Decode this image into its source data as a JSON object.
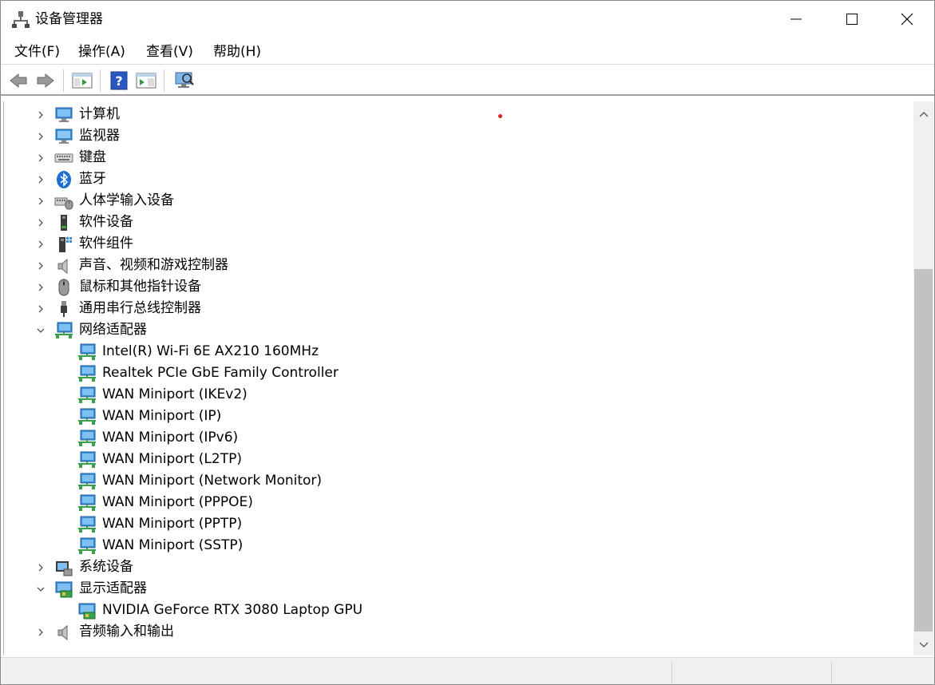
{
  "window": {
    "title": "设备管理器"
  },
  "menu": [
    "文件(F)",
    "操作(A)",
    "查看(V)",
    "帮助(H)"
  ],
  "toolbar": {
    "buttons": [
      "back-icon",
      "forward-icon",
      "properties-icon",
      "help-icon",
      "update-driver-icon",
      "scan-hardware-icon"
    ]
  },
  "tree": {
    "categories": [
      {
        "label": "计算机",
        "icon": "computer-icon",
        "expanded": false
      },
      {
        "label": "监视器",
        "icon": "monitor-icon",
        "expanded": false
      },
      {
        "label": "键盘",
        "icon": "keyboard-icon",
        "expanded": false
      },
      {
        "label": "蓝牙",
        "icon": "bluetooth-icon",
        "expanded": false
      },
      {
        "label": "人体学输入设备",
        "icon": "hid-icon",
        "expanded": false
      },
      {
        "label": "软件设备",
        "icon": "software-device-icon",
        "expanded": false
      },
      {
        "label": "软件组件",
        "icon": "software-component-icon",
        "expanded": false
      },
      {
        "label": "声音、视频和游戏控制器",
        "icon": "speaker-icon",
        "expanded": false
      },
      {
        "label": "鼠标和其他指针设备",
        "icon": "mouse-icon",
        "expanded": false
      },
      {
        "label": "通用串行总线控制器",
        "icon": "usb-icon",
        "expanded": false
      },
      {
        "label": "网络适配器",
        "icon": "network-adapter-icon",
        "expanded": true,
        "children": [
          "Intel(R) Wi-Fi 6E AX210 160MHz",
          "Realtek PCIe GbE Family Controller",
          "WAN Miniport (IKEv2)",
          "WAN Miniport (IP)",
          "WAN Miniport (IPv6)",
          "WAN Miniport (L2TP)",
          "WAN Miniport (Network Monitor)",
          "WAN Miniport (PPPOE)",
          "WAN Miniport (PPTP)",
          "WAN Miniport (SSTP)"
        ]
      },
      {
        "label": "系统设备",
        "icon": "system-device-icon",
        "expanded": false
      },
      {
        "label": "显示适配器",
        "icon": "display-adapter-icon",
        "expanded": true,
        "children": [
          "NVIDIA GeForce RTX 3080 Laptop GPU"
        ]
      },
      {
        "label": "音频输入和输出",
        "icon": "speaker-icon",
        "expanded": false
      }
    ]
  },
  "colors": {
    "accent": "#1e73be",
    "window_border": "#8a8a8a",
    "statusbar": "#f0f0f0",
    "scroll_thumb": "#c2c2c2"
  }
}
